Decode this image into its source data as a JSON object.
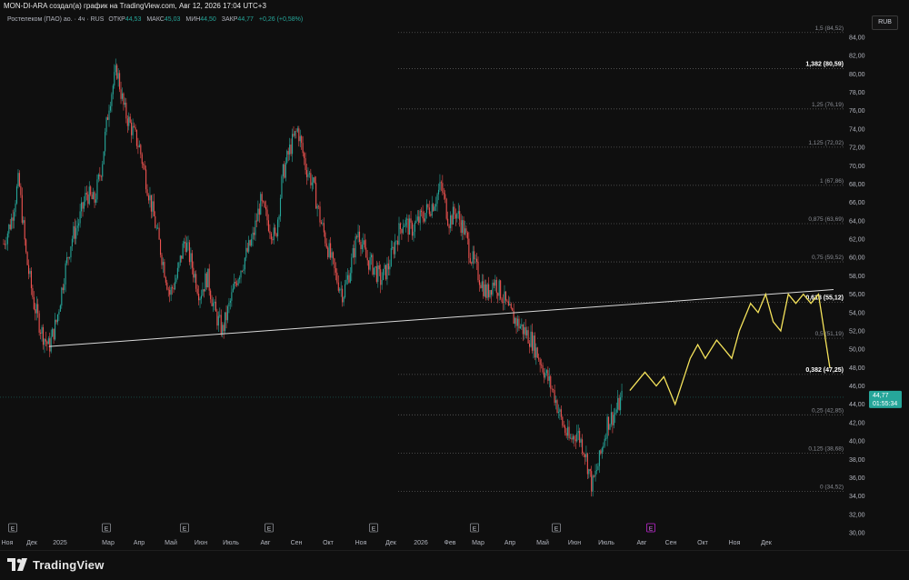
{
  "header": {
    "title": "MON-DI-ARA создал(а) график на TradingView.com, Авг 12, 2026 17:04 UTC+3"
  },
  "legend": {
    "symbol": "Ростелеком (ПАО) ао. · 4ч · RUS",
    "open_label": "ОТКР",
    "open": "44,53",
    "high_label": "МАКС",
    "high": "45,03",
    "low_label": "МИН",
    "low": "44,50",
    "close_label": "ЗАКР",
    "close": "44,77",
    "change": "+0,26 (+0,58%)"
  },
  "currency": "RUB",
  "price_tag": {
    "price": "44,77",
    "countdown": "01:55:34"
  },
  "footer": {
    "brand": "TradingView"
  },
  "chart_data": {
    "type": "candlestick",
    "y_axis": {
      "min": 30,
      "max": 84,
      "step": 2,
      "labels": [
        "84,00",
        "82,00",
        "80,00",
        "78,00",
        "76,00",
        "74,00",
        "72,00",
        "70,00",
        "68,00",
        "66,00",
        "64,00",
        "62,00",
        "60,00",
        "58,00",
        "56,00",
        "54,00",
        "52,00",
        "50,00",
        "48,00",
        "46,00",
        "44,00",
        "42,00",
        "40,00",
        "38,00",
        "36,00",
        "34,00",
        "32,00",
        "30,00"
      ]
    },
    "x_axis": {
      "labels": [
        "Ноя",
        "Дек",
        "2025",
        "Мар",
        "Апр",
        "Май",
        "Июн",
        "Июль",
        "Авг",
        "Сен",
        "Окт",
        "Ноя",
        "Дек",
        "2026",
        "Фев",
        "Мар",
        "Апр",
        "Май",
        "Июн",
        "Июль",
        "Авг",
        "Сен",
        "Окт",
        "Ноя",
        "Дек"
      ]
    },
    "price_path": [
      [
        0,
        61.5
      ],
      [
        1,
        64
      ],
      [
        2,
        68.5
      ],
      [
        3,
        60
      ],
      [
        4,
        55
      ],
      [
        5,
        52
      ],
      [
        6,
        50.2
      ],
      [
        7,
        53
      ],
      [
        8,
        58
      ],
      [
        9,
        62
      ],
      [
        10,
        64
      ],
      [
        11,
        67
      ],
      [
        12,
        66
      ],
      [
        13,
        70
      ],
      [
        14,
        77
      ],
      [
        15,
        80.5
      ],
      [
        16,
        76
      ],
      [
        17,
        74
      ],
      [
        18,
        72
      ],
      [
        19,
        68
      ],
      [
        20,
        64
      ],
      [
        21,
        60
      ],
      [
        22,
        56
      ],
      [
        23,
        58
      ],
      [
        24,
        62
      ],
      [
        25,
        59
      ],
      [
        26,
        56
      ],
      [
        27,
        58
      ],
      [
        28,
        54
      ],
      [
        29,
        52
      ],
      [
        30,
        55
      ],
      [
        31,
        58
      ],
      [
        32,
        60
      ],
      [
        33,
        62
      ],
      [
        34,
        66
      ],
      [
        35,
        64
      ],
      [
        36,
        62
      ],
      [
        37,
        69
      ],
      [
        38,
        72
      ],
      [
        39,
        74
      ],
      [
        40,
        70
      ],
      [
        41,
        68
      ],
      [
        42,
        64
      ],
      [
        43,
        61
      ],
      [
        44,
        58
      ],
      [
        45,
        56
      ],
      [
        46,
        59
      ],
      [
        47,
        63
      ],
      [
        48,
        60
      ],
      [
        49,
        59
      ],
      [
        50,
        57.5
      ],
      [
        51,
        59
      ],
      [
        52,
        62
      ],
      [
        53,
        64
      ],
      [
        54,
        63
      ],
      [
        55,
        64
      ],
      [
        56,
        65
      ],
      [
        57,
        66
      ],
      [
        58,
        67.8
      ],
      [
        59,
        64
      ],
      [
        60,
        65
      ],
      [
        61,
        63
      ],
      [
        62,
        60
      ],
      [
        63,
        58
      ],
      [
        64,
        56
      ],
      [
        65,
        57.5
      ],
      [
        66,
        56
      ],
      [
        67,
        54
      ],
      [
        68,
        53
      ],
      [
        69,
        52
      ],
      [
        70,
        51
      ],
      [
        71,
        49
      ],
      [
        72,
        47
      ],
      [
        73,
        45
      ],
      [
        74,
        42
      ],
      [
        75,
        40
      ],
      [
        76,
        41
      ],
      [
        77,
        39
      ],
      [
        78,
        35
      ],
      [
        79,
        38
      ],
      [
        80,
        42
      ],
      [
        81,
        43
      ],
      [
        82,
        44.77
      ]
    ],
    "forecast_path": [
      [
        83,
        45.5
      ],
      [
        85,
        47.5
      ],
      [
        86.5,
        46
      ],
      [
        87.5,
        47
      ],
      [
        89,
        44
      ],
      [
        91,
        49
      ],
      [
        92,
        50.5
      ],
      [
        93,
        49
      ],
      [
        94.5,
        51
      ],
      [
        95.5,
        50
      ],
      [
        96.5,
        49
      ],
      [
        97.5,
        52
      ],
      [
        99,
        55
      ],
      [
        100,
        54
      ],
      [
        101,
        56
      ],
      [
        102,
        53
      ],
      [
        103,
        52
      ],
      [
        104,
        56
      ],
      [
        105,
        55
      ],
      [
        106,
        56
      ],
      [
        107,
        55
      ],
      [
        108,
        56
      ],
      [
        109.5,
        48
      ]
    ],
    "trendline": {
      "from": [
        6,
        50.3
      ],
      "to": [
        110,
        56.5
      ]
    },
    "fibonacci": [
      {
        "ratio": "1,5",
        "price": "84,52",
        "value": 84.52,
        "emphasis": false
      },
      {
        "ratio": "1,382",
        "price": "80,59",
        "value": 80.59,
        "emphasis": true
      },
      {
        "ratio": "1,25",
        "price": "76,19",
        "value": 76.19,
        "emphasis": false
      },
      {
        "ratio": "1,125",
        "price": "72,02",
        "value": 72.02,
        "emphasis": false
      },
      {
        "ratio": "1",
        "price": "67,86",
        "value": 67.86,
        "emphasis": false
      },
      {
        "ratio": "0,875",
        "price": "63,69",
        "value": 63.69,
        "emphasis": false
      },
      {
        "ratio": "0,75",
        "price": "59,52",
        "value": 59.52,
        "emphasis": false
      },
      {
        "ratio": "0,618",
        "price": "55,12",
        "value": 55.12,
        "emphasis": true
      },
      {
        "ratio": "0,5",
        "price": "51,19",
        "value": 51.19,
        "emphasis": false
      },
      {
        "ratio": "0,382",
        "price": "47,25",
        "value": 47.25,
        "emphasis": true
      },
      {
        "ratio": "0,25",
        "price": "42,85",
        "value": 42.85,
        "emphasis": false
      },
      {
        "ratio": "0,125",
        "price": "38,68",
        "value": 38.68,
        "emphasis": false
      },
      {
        "ratio": "0",
        "price": "34,52",
        "value": 34.52,
        "emphasis": false
      }
    ],
    "earnings_markers": [
      "E",
      "E",
      "E",
      "E",
      "E",
      "E",
      "E",
      "E"
    ],
    "colors": {
      "up": "#26a69a",
      "down": "#ef5350",
      "forecast": "#f5e35b",
      "trendline": "#d9d9d9",
      "fib": "#5a5a5a",
      "price_tag": "#26a69a"
    }
  }
}
